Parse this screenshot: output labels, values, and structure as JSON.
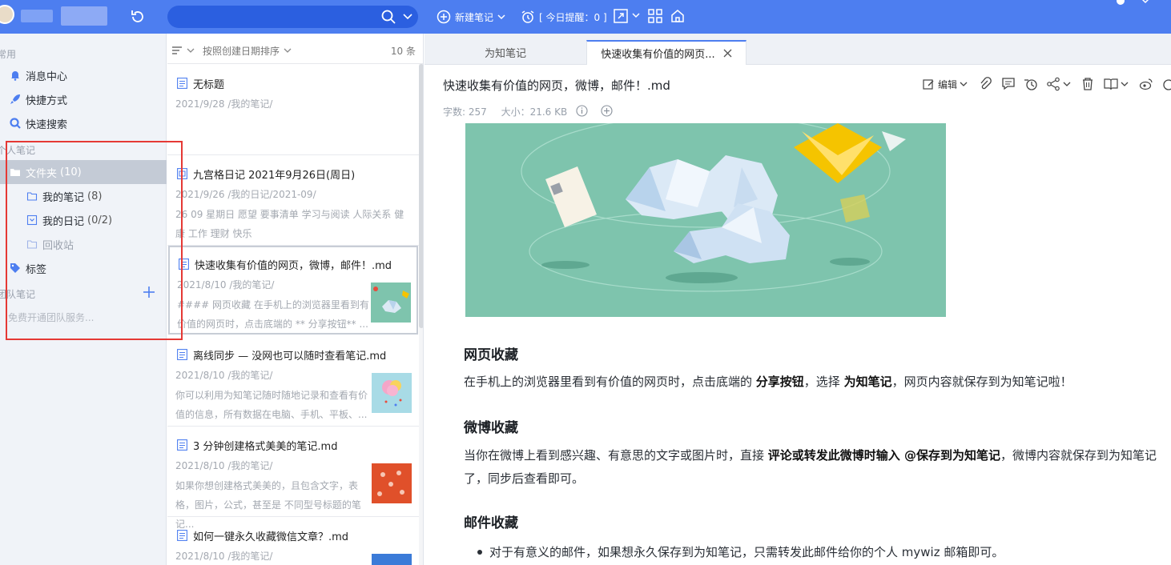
{
  "topbar": {
    "new_note_label": "新建笔记",
    "reminder_label": "[ 今日提醒：0 ]"
  },
  "sidebar": {
    "common_section": "常用",
    "items": [
      {
        "label": "消息中心"
      },
      {
        "label": "快捷方式"
      },
      {
        "label": "快速搜索"
      }
    ],
    "personal_section": "个人笔记",
    "folder_label": "文件夹",
    "folder_count": "(10)",
    "sub_folders": [
      {
        "label": "我的笔记",
        "count": "(8)"
      },
      {
        "label": "我的日记",
        "count": "(0/2)"
      },
      {
        "label": "回收站",
        "count": ""
      }
    ],
    "tags_label": "标签",
    "team_section": "团队笔记",
    "team_hint": "免费开通团队服务..."
  },
  "notelist": {
    "sort_label": "按照创建日期排序",
    "count_label": "10 条",
    "notes": [
      {
        "title": "无标题",
        "meta": "2021/9/28   /我的笔记/",
        "excerpt": ""
      },
      {
        "title": "九宫格日记 2021年9月26日(周日)",
        "meta": "2021/9/26   /我的日记/2021-09/",
        "excerpt": " 26 09 星期日 愿望 要事清单 学习与阅读 人际关系 健康 工作 理财 快乐"
      },
      {
        "title": "快速收集有价值的网页，微博，邮件！.md",
        "meta": "2021/8/10   /我的笔记/",
        "excerpt": " #### 网页收藏 在手机上的浏览器里看到有价值的网页时，点击底端的 ** 分享按钮** ..."
      },
      {
        "title": "离线同步 — 没网也可以随时查看笔记.md",
        "meta": "2021/8/10   /我的笔记/",
        "excerpt": "你可以利用为知笔记随时随地记录和查看有价值的信息，所有数据在电脑、手机、平板、..."
      },
      {
        "title": "3 分钟创建格式美美的笔记.md",
        "meta": "2021/8/10   /我的笔记/",
        "excerpt": "如果你想创建格式美美的，且包含文字，表格，图片，公式，甚至是 不同型号标题的笔记..."
      },
      {
        "title": "如何一键永久收藏微信文章？.md",
        "meta": "2021/8/10   /我的笔记/",
        "excerpt": ""
      }
    ]
  },
  "tabs": [
    {
      "label": "为知笔记"
    },
    {
      "label": "快速收集有价值的网页..."
    }
  ],
  "editor": {
    "title": "快速收集有价值的网页，微博，邮件！.md",
    "word_count": "字数: 257",
    "size": "大小：21.6 KB",
    "edit_label": "编辑",
    "sections": [
      {
        "heading": "网页收藏",
        "p1": "在手机上的浏览器里看到有价值的网页时，点击底端的 ",
        "b1": "分享按钮",
        "p2": "，选择 ",
        "b2": "为知笔记",
        "p3": "，网页内容就保存到为知笔记啦！"
      },
      {
        "heading": "微博收藏",
        "p1": "当你在微博上看到感兴趣、有意思的文字或图片时，直接 ",
        "b1": "评论或转发此微博时输入 @保存到为知笔记",
        "p2": "，微博内容就保存到为知笔记了，同步后查看即可。"
      },
      {
        "heading": "邮件收藏",
        "bullet": "对于有意义的邮件，如果想永久保存到为知笔记，只需转发此邮件给你的个人 mywiz 邮箱即可。"
      }
    ]
  },
  "colors": {
    "topbar": "#4d7ef0",
    "search_bg": "#2b5fe0",
    "sidebar_bg": "#f0f3f8",
    "selected_folder": "#c4cbd6",
    "annotation_red": "#e53935",
    "hero_bg": "#7ec4ad"
  },
  "icons": [
    "sync-icon",
    "search-icon",
    "plus-circle-icon",
    "alarm-icon",
    "expand-icon",
    "grid-icon",
    "home-icon",
    "bell-icon",
    "rocket-icon",
    "magnifier-icon",
    "folder-icon",
    "calendar-icon",
    "tag-icon",
    "plus-icon",
    "sort-icon",
    "note-icon",
    "close-icon",
    "edit-icon",
    "attachment-icon",
    "comment-icon",
    "history-icon",
    "share-icon",
    "trash-icon",
    "book-icon",
    "info-icon"
  ]
}
